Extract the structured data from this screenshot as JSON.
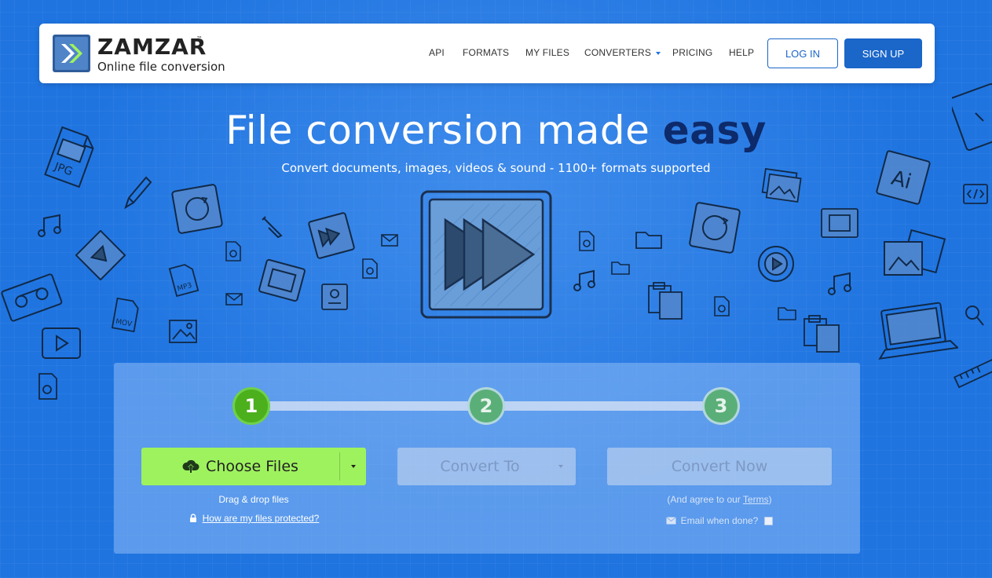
{
  "brand": {
    "name": "ZAMZAR",
    "trademark": "™",
    "tagline": "Online file conversion",
    "colors": {
      "primary": "#1a66c9",
      "background": "#1f74e0",
      "accent_green": "#9ef25e",
      "step_active": "#4caf1c"
    }
  },
  "nav": {
    "items": [
      {
        "label": "API"
      },
      {
        "label": "FORMATS"
      },
      {
        "label": "MY FILES"
      },
      {
        "label": "CONVERTERS",
        "has_dropdown": true
      },
      {
        "label": "PRICING"
      },
      {
        "label": "HELP"
      }
    ],
    "login_label": "LOG IN",
    "signup_label": "SIGN UP"
  },
  "hero": {
    "title_regular": "File conversion made",
    "title_strong": "easy",
    "subtitle": "Convert documents, images, videos & sound - 1100+ formats supported"
  },
  "converter": {
    "steps": [
      "1",
      "2",
      "3"
    ],
    "active_step": 1,
    "choose_files_label": "Choose Files",
    "drag_drop_text": "Drag & drop files",
    "protect_link": "How are my files protected?",
    "convert_to_label": "Convert To",
    "convert_now_label": "Convert Now",
    "agree_prefix": "(And agree to our",
    "terms_link": "Terms",
    "agree_suffix": ")",
    "email_label": "Email when done?",
    "email_checked": false
  },
  "decorative_icons": [
    "jpg-file-icon",
    "pencil-icon",
    "music-note-icon",
    "video-cassette-icon",
    "play-video-icon",
    "mp3-file-icon",
    "mov-file-icon",
    "image-icon",
    "wrench-icon",
    "film-strip-icon",
    "envelope-icon",
    "folder-icon",
    "clipboard-icon",
    "ai-file-icon",
    "code-icon",
    "magnifier-icon",
    "laptop-icon",
    "ruler-icon",
    "refresh-icon"
  ]
}
